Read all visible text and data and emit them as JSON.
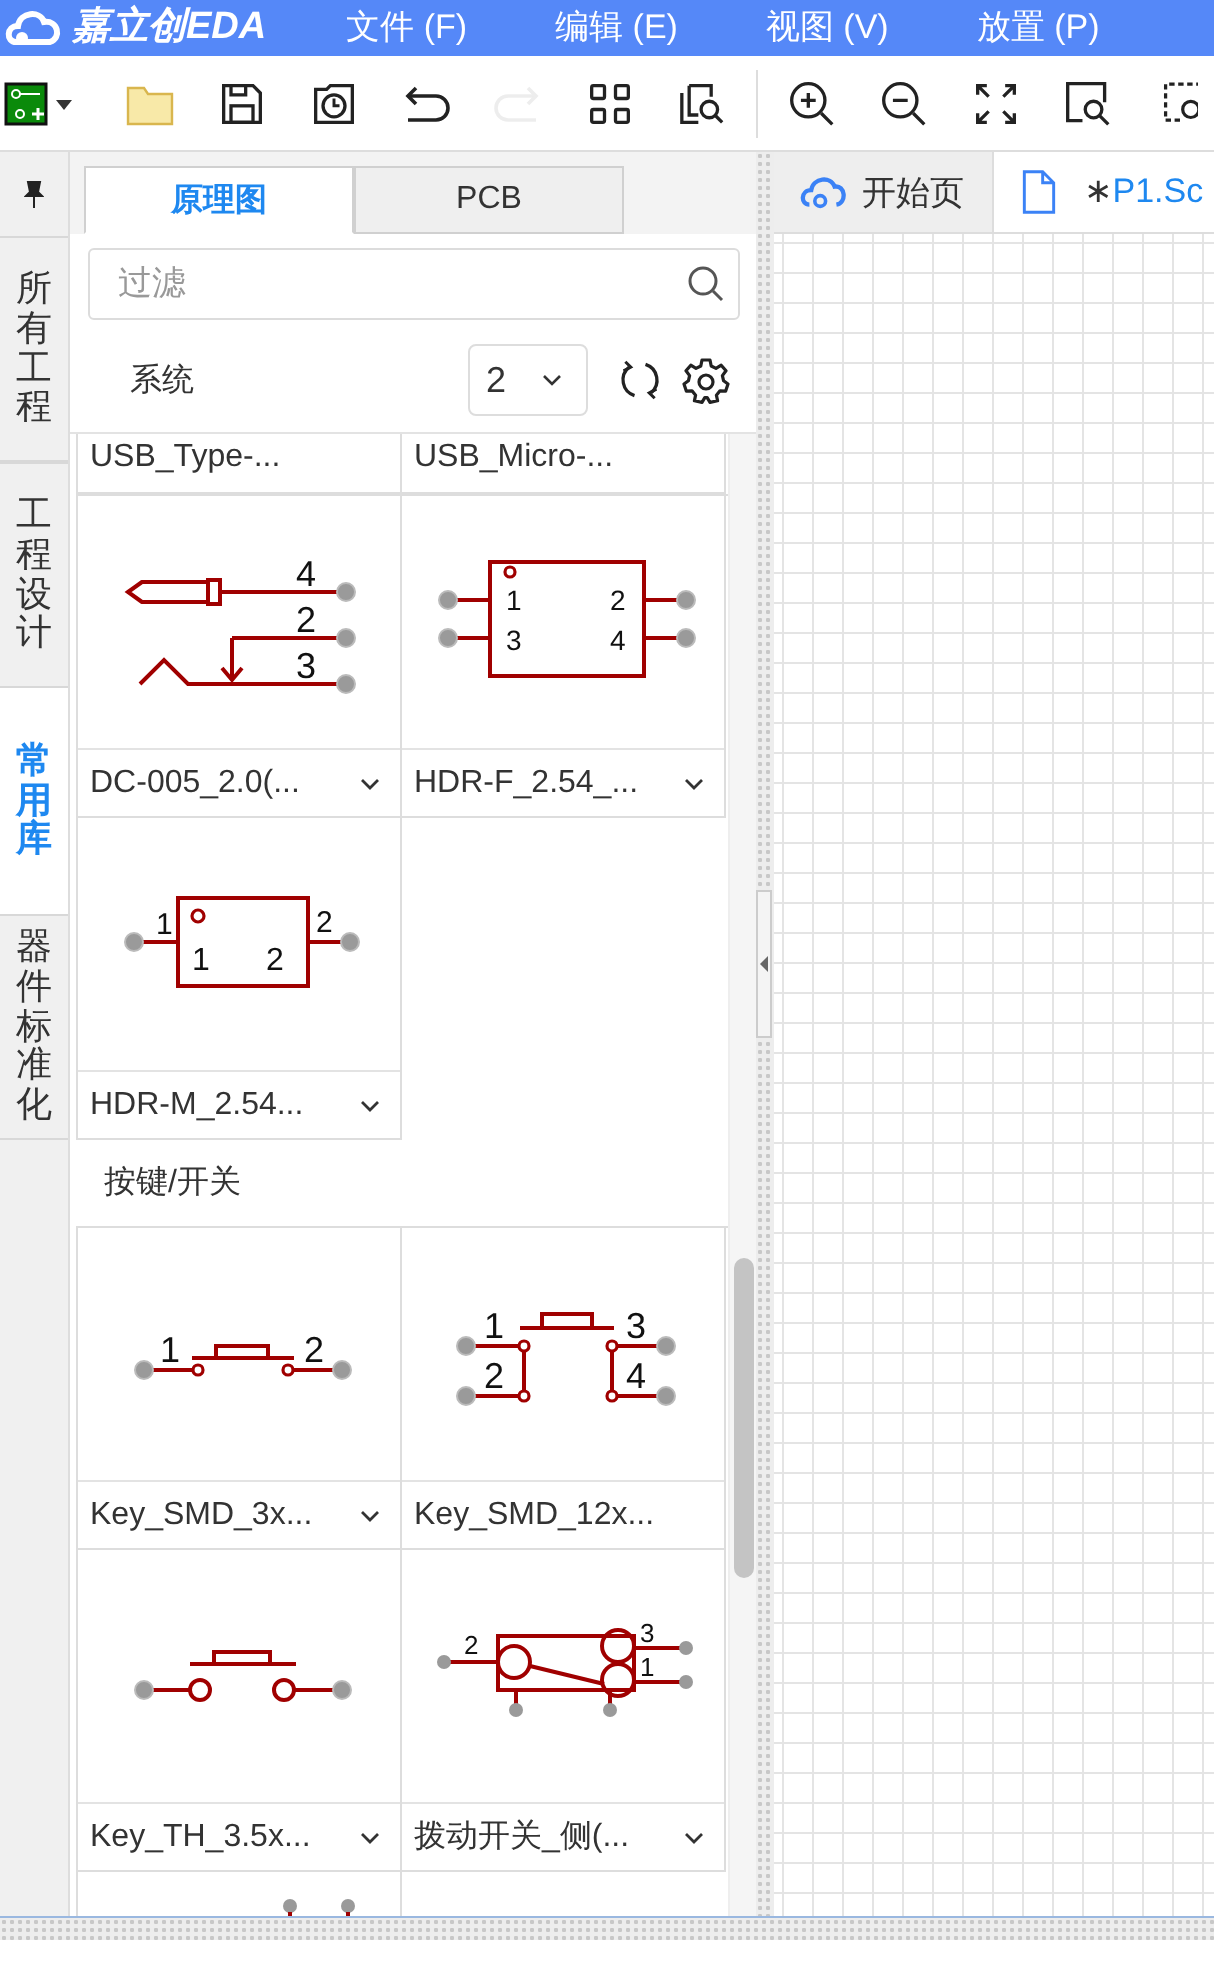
{
  "app": {
    "logo": "嘉立创EDA",
    "menu": [
      "文件 (F)",
      "编辑 (E)",
      "视图 (V)",
      "放置 (P)"
    ]
  },
  "toolbar": [
    {
      "items": [
        {
          "kind": "new-board",
          "disabled": false
        },
        {
          "kind": "folder",
          "disabled": false
        },
        {
          "kind": "save",
          "disabled": false
        },
        {
          "kind": "history",
          "disabled": false
        },
        {
          "kind": "undo",
          "disabled": false
        },
        {
          "kind": "redo",
          "disabled": true
        },
        {
          "kind": "grid",
          "disabled": false
        },
        {
          "kind": "find",
          "disabled": false
        }
      ]
    },
    {
      "items": [
        {
          "kind": "zoom-in",
          "disabled": false
        },
        {
          "kind": "zoom-out",
          "disabled": false
        },
        {
          "kind": "fit",
          "disabled": false
        },
        {
          "kind": "zoom-area",
          "disabled": false
        },
        {
          "kind": "zoom-select",
          "disabled": false
        }
      ]
    }
  ],
  "side_tabs": [
    {
      "label": "所有工程",
      "selected": false
    },
    {
      "label": "工程设计",
      "selected": false
    },
    {
      "label": "常用库",
      "selected": true
    },
    {
      "label": "器件标准化",
      "selected": false
    }
  ],
  "library": {
    "tabs": [
      {
        "label": "原理图",
        "selected": true
      },
      {
        "label": "PCB",
        "selected": false
      }
    ],
    "filter": {
      "placeholder": "过滤"
    },
    "source": "系统",
    "columns": "2",
    "sections": [
      {
        "cards": [
          {
            "name": "USB_Type-...",
            "kind": "label-only",
            "dropdown": false
          },
          {
            "name": "USB_Micro-...",
            "kind": "label-only",
            "dropdown": false
          }
        ]
      },
      {
        "cards": [
          {
            "name": "DC-005_2.0(...",
            "kind": "jack",
            "pins": [
              "4",
              "2",
              "3"
            ],
            "dropdown": true
          },
          {
            "name": "HDR-F_2.54_...",
            "kind": "hdr4",
            "pins": [
              "1",
              "3",
              "2",
              "4"
            ],
            "dropdown": true
          },
          {
            "name": "HDR-M_2.54...",
            "kind": "hdr2",
            "pins": [
              "1",
              "1",
              "2",
              "2"
            ],
            "dropdown": true
          }
        ]
      },
      {
        "title": "按键/开关",
        "cards": [
          {
            "name": "Key_SMD_3x...",
            "kind": "key2",
            "pins": [
              "1",
              "2"
            ],
            "dropdown": true
          },
          {
            "name": "Key_SMD_12x...",
            "kind": "key4",
            "pins": [
              "1",
              "2",
              "3",
              "4"
            ],
            "dropdown": false
          },
          {
            "name": "Key_TH_3.5x...",
            "kind": "keyth",
            "dropdown": true
          },
          {
            "name": "拨动开关_侧(...",
            "kind": "slide",
            "pins": [
              "2",
              "3",
              "1"
            ],
            "dropdown": true
          },
          {
            "kind": "partial"
          }
        ]
      }
    ]
  },
  "doc_tabs": [
    {
      "kind": "start",
      "label": "开始页",
      "selected": false
    },
    {
      "kind": "sheet",
      "mark": "∗",
      "label": "P1.Sc",
      "selected": true
    }
  ]
}
